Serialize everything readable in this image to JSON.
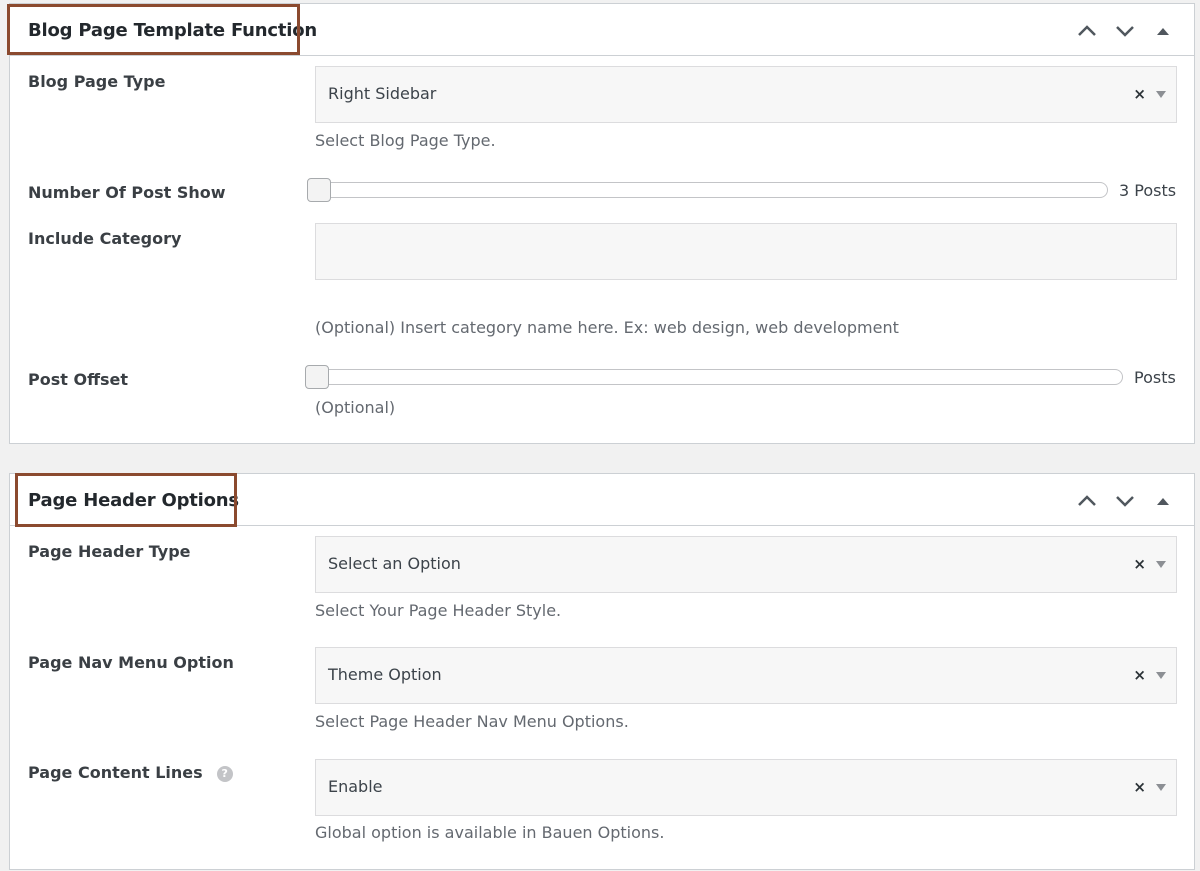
{
  "panels": {
    "blog": {
      "title": "Blog Page Template Function",
      "rows": {
        "page_type": {
          "label": "Blog Page Type",
          "value": "Right Sidebar",
          "clear": "×",
          "description": "Select Blog Page Type."
        },
        "post_count": {
          "label": "Number Of Post Show",
          "value_text": "3 Posts",
          "level": 0
        },
        "category": {
          "label": "Include Category",
          "value": "",
          "description": "(Optional) Insert category name here. Ex: web design, web development"
        },
        "offset": {
          "label": "Post Offset",
          "value_text": "Posts",
          "level": 0,
          "description": "(Optional)"
        }
      }
    },
    "header": {
      "title": "Page Header Options",
      "rows": {
        "header_type": {
          "label": "Page Header Type",
          "value": "Select an Option",
          "clear": "×",
          "description": "Select Your Page Header Style."
        },
        "nav_menu": {
          "label": "Page Nav Menu Option",
          "value": "Theme Option",
          "clear": "×",
          "description": "Select Page Header Nav Menu Options."
        },
        "content_lines": {
          "label": "Page Content Lines",
          "help": "?",
          "value": "Enable",
          "clear": "×",
          "description": "Global option is available in Bauen Options."
        }
      }
    }
  },
  "icons": {
    "move_up": "chevron-up-icon",
    "move_down": "chevron-down-icon",
    "toggle": "triangle-up-icon"
  },
  "colors": {
    "highlight_border": "#8b4a2f",
    "panel_border": "#ccd0d4",
    "background": "#f1f1f1"
  }
}
